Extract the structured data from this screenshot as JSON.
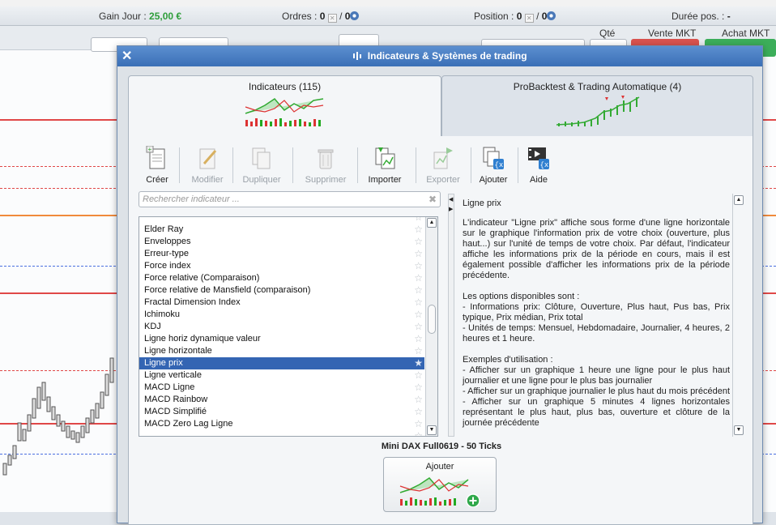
{
  "status_bar": {
    "gain_label": "Gain Jour :",
    "gain_value": "25,00 €",
    "orders_label": "Ordres :",
    "orders_value": "0",
    "orders_sep": "/",
    "orders_value2": "0",
    "position_label": "Position :",
    "position_value": "0",
    "position_sep": "/",
    "position_value2": "0",
    "duree_label": "Durée pos. :",
    "duree_value": "-"
  },
  "order_panel": {
    "qty_header": "Qté",
    "sell_header": "Vente MKT",
    "buy_header": "Achat MKT"
  },
  "dialog": {
    "title": "Indicateurs & Systèmes de trading",
    "close": "✕",
    "tabs": [
      {
        "label": "Indicateurs (115)"
      },
      {
        "label": "ProBacktest & Trading Automatique (4)"
      }
    ],
    "toolbar": {
      "create": "Créer",
      "modify": "Modifier",
      "duplicate": "Dupliquer",
      "delete": "Supprimer",
      "import": "Importer",
      "export": "Exporter",
      "add": "Ajouter",
      "help": "Aide"
    },
    "search_placeholder": "Rechercher indicateur ...",
    "list": [
      "Elder Ray",
      "Enveloppes",
      "Erreur-type",
      "Force index",
      "Force relative (Comparaison)",
      "Force relative de Mansfield (comparaison)",
      "Fractal Dimension Index",
      "Ichimoku",
      "KDJ",
      "Ligne horiz dynamique valeur",
      "Ligne horizontale",
      "Ligne prix",
      "Ligne verticale",
      "MACD Ligne",
      "MACD Rainbow",
      "MACD Simplifié",
      "MACD Zero Lag Ligne"
    ],
    "selected": "Ligne prix",
    "description_title": "Ligne prix",
    "description": "L'indicateur \"Ligne prix\" affiche sous forme d'une ligne horizontale sur le graphique l'information prix de votre choix (ouverture, plus haut...) sur l'unité de temps de votre choix. Par défaut, l'indicateur affiche les informations prix de la période en cours, mais il est également possible d'afficher les informations prix de la période précédente.\n\nLes options disponibles sont :\n- Informations prix: Clôture, Ouverture, Plus haut, Pus bas, Prix typique, Prix médian, Prix total\n- Unités de temps: Mensuel, Hebdomadaire, Journalier, 4 heures, 2 heures et 1 heure.\n\nExemples d'utilisation :\n- Afficher sur un graphique 1 heure une ligne pour le plus haut journalier et une ligne pour le plus bas journalier\n- Afficher sur un graphique journalier le plus haut du mois précédent\n- Afficher sur un graphique 5 minutes 4 lignes horizontales représentant le plus haut, plus bas, ouverture et clôture de la journée précédente",
    "context_title": "Mini DAX Full0619 - 50 Ticks",
    "add_button": "Ajouter"
  },
  "colors": {
    "title_bar": "#3a6fb6",
    "selection": "#3465b3",
    "gain": "#2e9e3a"
  }
}
